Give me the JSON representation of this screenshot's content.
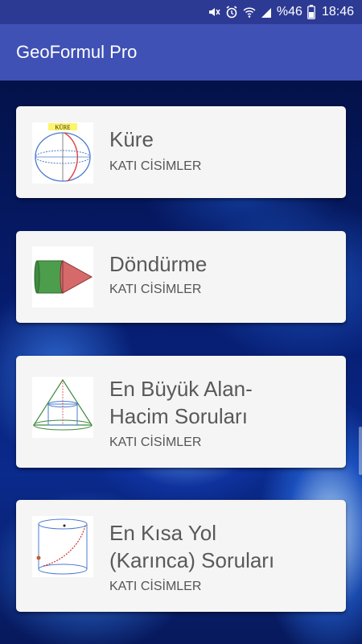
{
  "status_bar": {
    "battery_text": "%46",
    "time": "18:46",
    "icons": [
      "mute-icon",
      "alarm-icon",
      "wifi-icon",
      "signal-icon",
      "battery-icon"
    ]
  },
  "app_bar": {
    "title": "GeoFormul Pro"
  },
  "cards": [
    {
      "title_line1": "Küre",
      "title_line2": "",
      "subtitle": "KATI CİSİMLER",
      "thumbnail_icon": "sphere-icon",
      "thumbnail_label": "KÜRE"
    },
    {
      "title_line1": "Döndürme",
      "title_line2": "",
      "subtitle": "KATI CİSİMLER",
      "thumbnail_icon": "rotation-solid-icon"
    },
    {
      "title_line1": "En Büyük Alan-",
      "title_line2": "Hacim Soruları",
      "subtitle": "KATI CİSİMLER",
      "thumbnail_icon": "cone-cylinder-icon"
    },
    {
      "title_line1": "En Kısa Yol",
      "title_line2": "(Karınca) Soruları",
      "subtitle": "KATI CİSİMLER",
      "thumbnail_icon": "cylinder-path-icon"
    }
  ],
  "colors": {
    "status_bar": "#2d3a93",
    "app_bar": "#3f51b5",
    "card": "#f5f5f5",
    "title_text": "#595959"
  }
}
